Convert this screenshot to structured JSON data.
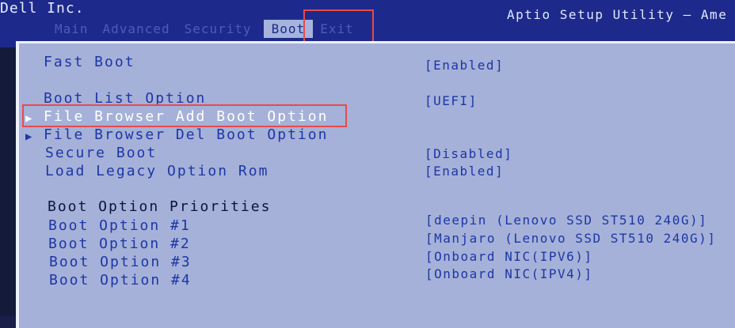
{
  "header": {
    "brand": "Dell Inc.",
    "utility_title": "Aptio Setup Utility – Ame",
    "tabs": [
      {
        "label": "Main"
      },
      {
        "label": "Advanced"
      },
      {
        "label": "Security"
      },
      {
        "label": "Boot"
      },
      {
        "label": "Exit"
      }
    ]
  },
  "boot_menu": {
    "fast_boot": {
      "label": "Fast Boot",
      "value": "[Enabled]"
    },
    "boot_list_option": {
      "label": "Boot List Option",
      "value": "[UEFI]"
    },
    "file_browser_add": {
      "label": "File Browser Add Boot Option"
    },
    "file_browser_del": {
      "label": "File Browser Del Boot Option"
    },
    "secure_boot": {
      "label": "Secure Boot",
      "value": "[Disabled]"
    },
    "load_legacy_rom": {
      "label": "Load Legacy Option Rom",
      "value": "[Enabled]"
    },
    "priorities_heading": "Boot Option Priorities",
    "options": [
      {
        "label": "Boot Option #1",
        "value": "[deepin (Lenovo SSD ST510 240G)]"
      },
      {
        "label": "Boot Option #2",
        "value": "[Manjaro (Lenovo SSD ST510 240G)]"
      },
      {
        "label": "Boot Option #3",
        "value": "[Onboard NIC(IPV6)]"
      },
      {
        "label": "Boot Option #4",
        "value": "[Onboard NIC(IPV4)]"
      }
    ]
  },
  "icons": {
    "submenu_arrow": "triangle-right-icon"
  },
  "colors": {
    "header_bg": "#1d2a8c",
    "panel_bg": "#a5b1d8",
    "item_text": "#1d37a6",
    "selected_text": "#ffffff",
    "annotation_highlight": "#e94a4a"
  }
}
